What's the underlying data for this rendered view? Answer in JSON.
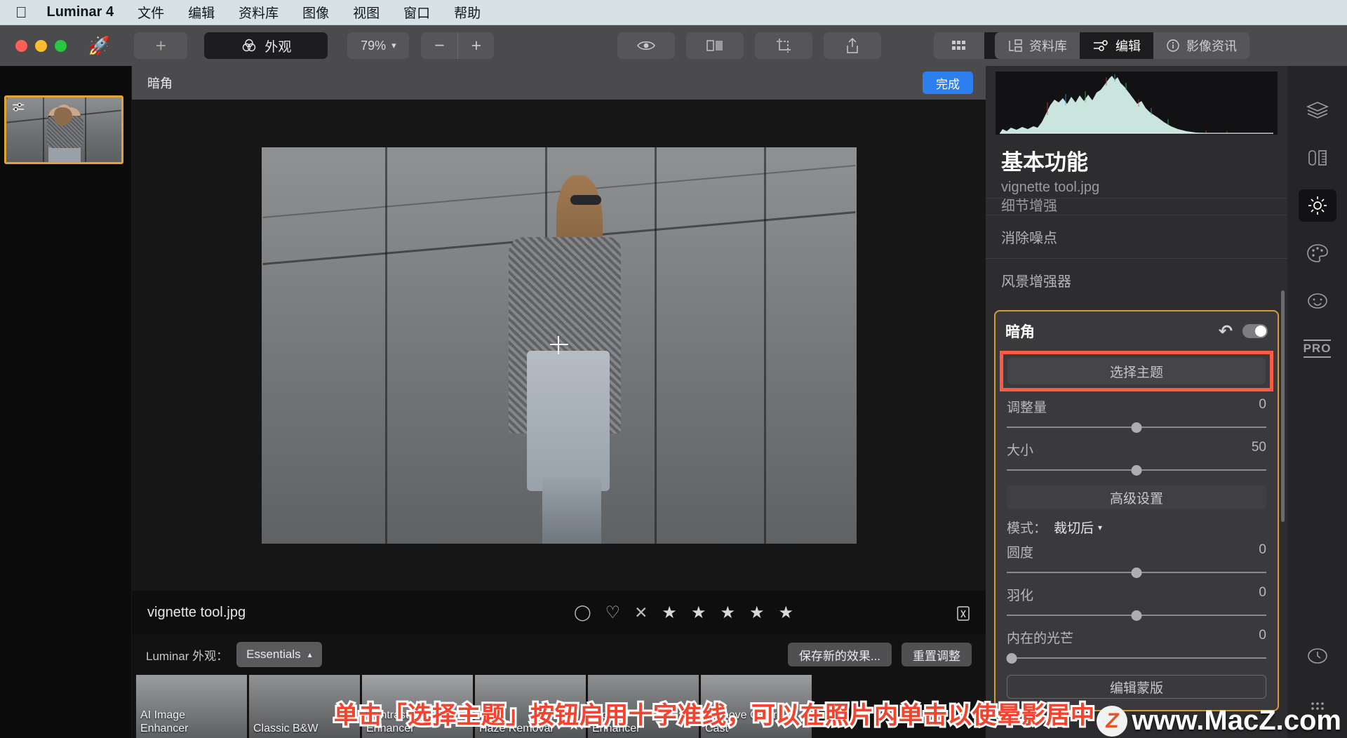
{
  "menubar": {
    "apple_glyph": "",
    "app_name": "Luminar 4",
    "items": [
      "文件",
      "编辑",
      "资料库",
      "图像",
      "视图",
      "窗口",
      "帮助"
    ]
  },
  "toolbar": {
    "add_label": "+",
    "looks_label": "外观",
    "zoom_value": "79%",
    "zoom_out": "−",
    "zoom_in": "+",
    "center_tools": [
      "eye-icon",
      "compare-icon",
      "crop-icon",
      "share-icon"
    ],
    "view_modes": [
      "grid-icon",
      "single-icon"
    ],
    "tabs": [
      {
        "label": "资料库",
        "icon": "library-icon",
        "active": false
      },
      {
        "label": "编辑",
        "icon": "sliders-icon",
        "active": true
      },
      {
        "label": "影像资讯",
        "icon": "info-icon",
        "active": false
      }
    ]
  },
  "canvas": {
    "breadcrumb": "暗角",
    "done_label": "完成",
    "file_name": "vignette tool.jpg",
    "rating_stars": 5,
    "reject_glyph": "✕",
    "heart_glyph": "♡",
    "flag_glyph": "◯"
  },
  "looksbar": {
    "label": "Luminar 外观：",
    "collection": "Essentials",
    "save_label": "保存新的效果...",
    "reset_label": "重置调整"
  },
  "presets": [
    {
      "label": "AI Image\nEnhancer",
      "favorite": false
    },
    {
      "label": "Classic B&W",
      "favorite": false
    },
    {
      "label": "Contrast\nEnhancer",
      "favorite": false
    },
    {
      "label": "Haze Removal",
      "favorite": true
    },
    {
      "label": "Mood\nEnhancer",
      "favorite": false
    },
    {
      "label": "Remove Color\nCast",
      "favorite": false
    }
  ],
  "annotation": {
    "text": "单击「选择主题」按钮启用十字准线，可以在照片内单击以使晕影居中",
    "color": "#f2442e"
  },
  "right_panel": {
    "title": "基本功能",
    "file_name": "vignette tool.jpg",
    "sections_above": [
      "细节增强",
      "消除噪点",
      "风景增强器"
    ],
    "vignette": {
      "title": "暗角",
      "reset_glyph": "↶",
      "toggle_on": true,
      "subject_button": "选择主题",
      "sliders": [
        {
          "label": "调整量",
          "value": "0",
          "knob_pct": 50
        },
        {
          "label": "大小",
          "value": "50",
          "knob_pct": 50
        }
      ],
      "advanced_label": "高级设置",
      "mode_label": "模式：",
      "mode_value": "裁切后",
      "advanced_sliders": [
        {
          "label": "圆度",
          "value": "0",
          "knob_pct": 50
        },
        {
          "label": "羽化",
          "value": "0",
          "knob_pct": 50
        },
        {
          "label": "内在的光芒",
          "value": "0",
          "knob_pct": 2
        }
      ],
      "mask_label": "编辑蒙版"
    }
  },
  "rail": {
    "icons": [
      {
        "name": "layers-icon",
        "active": false
      },
      {
        "name": "tools-icon",
        "active": false
      },
      {
        "name": "sun-icon",
        "active": true
      },
      {
        "name": "palette-icon",
        "active": false
      },
      {
        "name": "portrait-icon",
        "active": false
      },
      {
        "name": "pro-icon",
        "active": false
      }
    ],
    "bottom_icons": [
      {
        "name": "history-icon"
      },
      {
        "name": "more-icon"
      }
    ],
    "pro_label": "PRO"
  },
  "watermark": {
    "badge": "Z",
    "text": "www.MacZ.com"
  },
  "colors": {
    "accent_blue": "#2d7ff0",
    "highlight_orange": "#d79b33",
    "annotation_red": "#fb5c48"
  }
}
